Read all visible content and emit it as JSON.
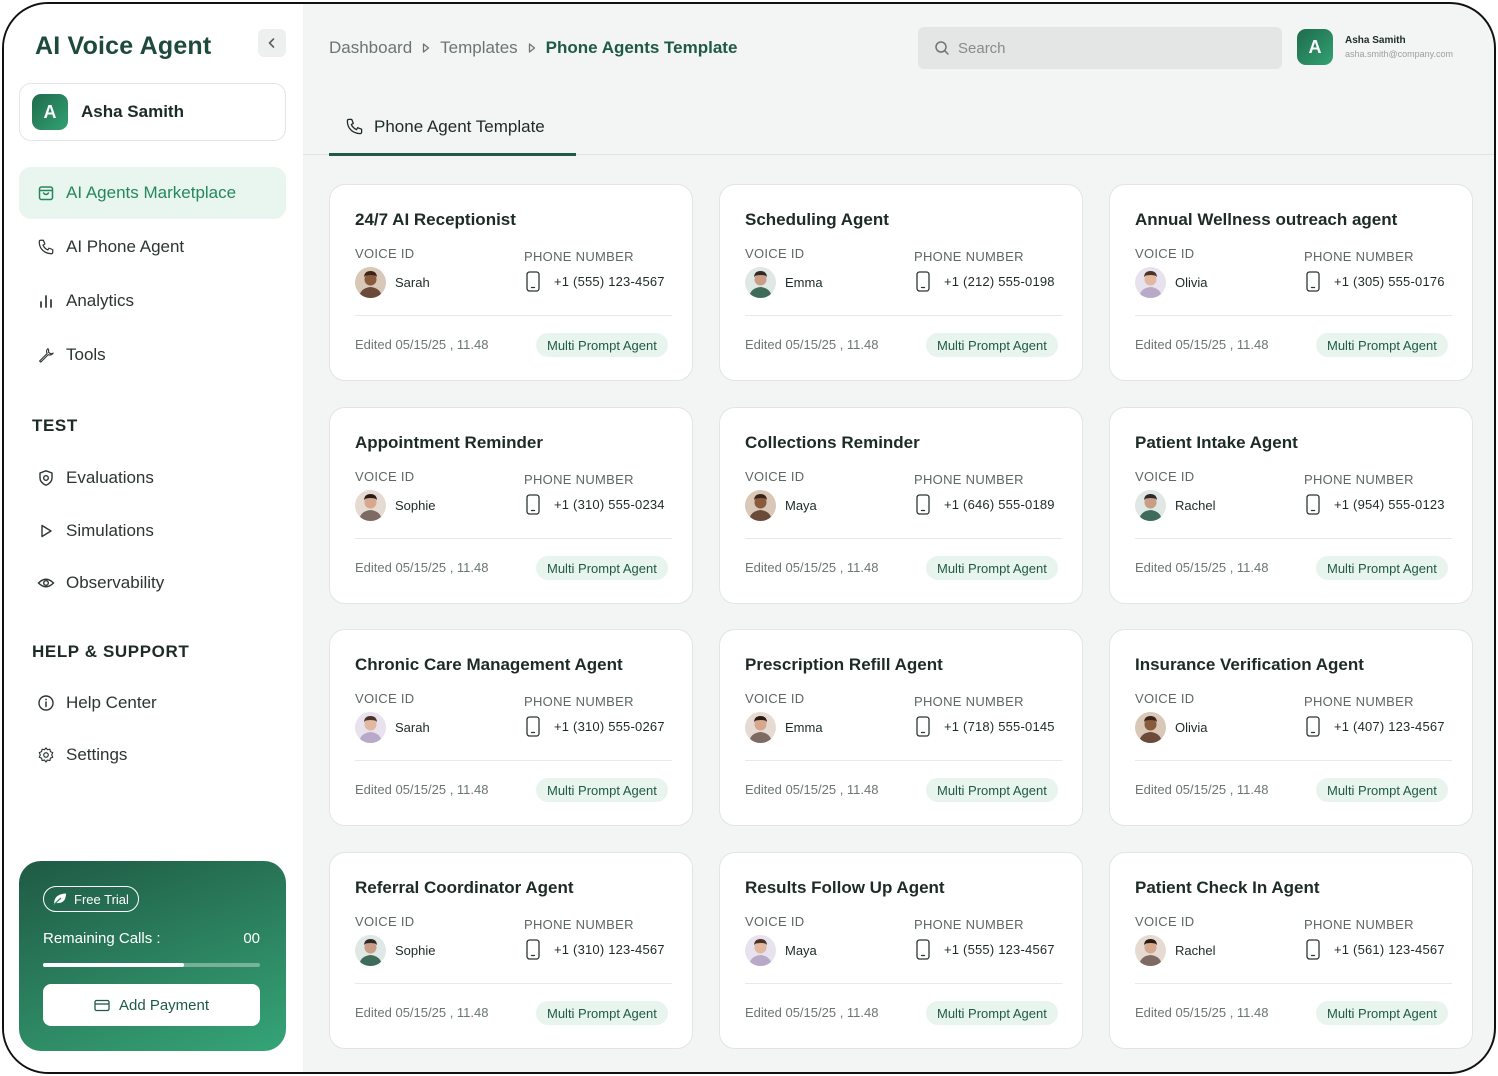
{
  "app": {
    "title": "AI Voice Agent"
  },
  "sidebar": {
    "user_initial": "A",
    "user_name": "Asha Samith",
    "nav": [
      {
        "label": "AI Agents Marketplace",
        "icon": "shopping-bag-icon",
        "active": true
      },
      {
        "label": "AI Phone Agent",
        "icon": "phone-icon"
      },
      {
        "label": "Analytics",
        "icon": "bar-chart-icon"
      },
      {
        "label": "Tools",
        "icon": "wrench-icon"
      }
    ],
    "test_title": "TEST",
    "test_items": [
      {
        "label": "Evaluations",
        "icon": "shield-icon"
      },
      {
        "label": "Simulations",
        "icon": "play-icon"
      },
      {
        "label": "Observability",
        "icon": "eye-icon"
      }
    ],
    "help_title": "HELP & SUPPORT",
    "help_items": [
      {
        "label": "Help Center",
        "icon": "info-icon"
      },
      {
        "label": "Settings",
        "icon": "gear-icon"
      }
    ],
    "trial": {
      "badge": "Free Trial",
      "remaining_label": "Remaining Calls :",
      "remaining_value": "00",
      "progress_fraction": 0.65,
      "button_label": "Add Payment"
    }
  },
  "header": {
    "breadcrumb": [
      "Dashboard",
      "Templates",
      "Phone Agents Template"
    ],
    "search_placeholder": "Search",
    "user_initial": "A",
    "user_name": "Asha Samith",
    "user_email": "asha.smith@company.com"
  },
  "tab": {
    "label": "Phone Agent Template"
  },
  "labels": {
    "voice_id": "VOICE ID",
    "phone_number": "PHONE NUMBER"
  },
  "colors": {
    "accent": "#1f5a44",
    "accent_light": "#e8f4ee",
    "active_text": "#25885c"
  },
  "cards": [
    {
      "title": "24/7 AI Receptionist",
      "voice": "Sarah",
      "phone": "+1 (555) 123-4567",
      "edited": "Edited 05/15/25 , 11.48",
      "badge": "Multi Prompt Agent"
    },
    {
      "title": "Scheduling Agent",
      "voice": "Emma",
      "phone": "+1 (212) 555-0198",
      "edited": "Edited 05/15/25 , 11.48",
      "badge": "Multi Prompt Agent"
    },
    {
      "title": "Annual Wellness outreach agent",
      "voice": "Olivia",
      "phone": "+1 (305) 555-0176",
      "edited": "Edited 05/15/25 , 11.48",
      "badge": "Multi Prompt Agent"
    },
    {
      "title": "Appointment Reminder",
      "voice": "Sophie",
      "phone": "+1 (310) 555-0234",
      "edited": "Edited 05/15/25 , 11.48",
      "badge": "Multi Prompt Agent"
    },
    {
      "title": "Collections Reminder",
      "voice": "Maya",
      "phone": "+1 (646) 555-0189",
      "edited": "Edited 05/15/25 , 11.48",
      "badge": "Multi Prompt Agent"
    },
    {
      "title": "Patient Intake Agent",
      "voice": "Rachel",
      "phone": "+1 (954) 555-0123",
      "edited": "Edited 05/15/25 , 11.48",
      "badge": "Multi Prompt Agent"
    },
    {
      "title": "Chronic Care Management Agent",
      "voice": "Sarah",
      "phone": "+1 (310) 555-0267",
      "edited": "Edited 05/15/25 , 11.48",
      "badge": "Multi Prompt Agent"
    },
    {
      "title": "Prescription Refill Agent",
      "voice": "Emma",
      "phone": "+1 (718) 555-0145",
      "edited": "Edited 05/15/25 , 11.48",
      "badge": "Multi Prompt Agent"
    },
    {
      "title": "Insurance Verification Agent",
      "voice": "Olivia",
      "phone": "+1 (407) 123-4567",
      "edited": "Edited 05/15/25 , 11.48",
      "badge": "Multi Prompt Agent"
    },
    {
      "title": "Referral Coordinator Agent",
      "voice": "Sophie",
      "phone": "+1 (310) 123-4567",
      "edited": "Edited 05/15/25 , 11.48",
      "badge": "Multi Prompt Agent"
    },
    {
      "title": "Results Follow Up Agent",
      "voice": "Maya",
      "phone": "+1 (555) 123-4567",
      "edited": "Edited 05/15/25 , 11.48",
      "badge": "Multi Prompt Agent"
    },
    {
      "title": "Patient Check In Agent",
      "voice": "Rachel",
      "phone": "+1 (561) 123-4567",
      "edited": "Edited 05/15/25 , 11.48",
      "badge": "Multi Prompt Agent"
    }
  ]
}
